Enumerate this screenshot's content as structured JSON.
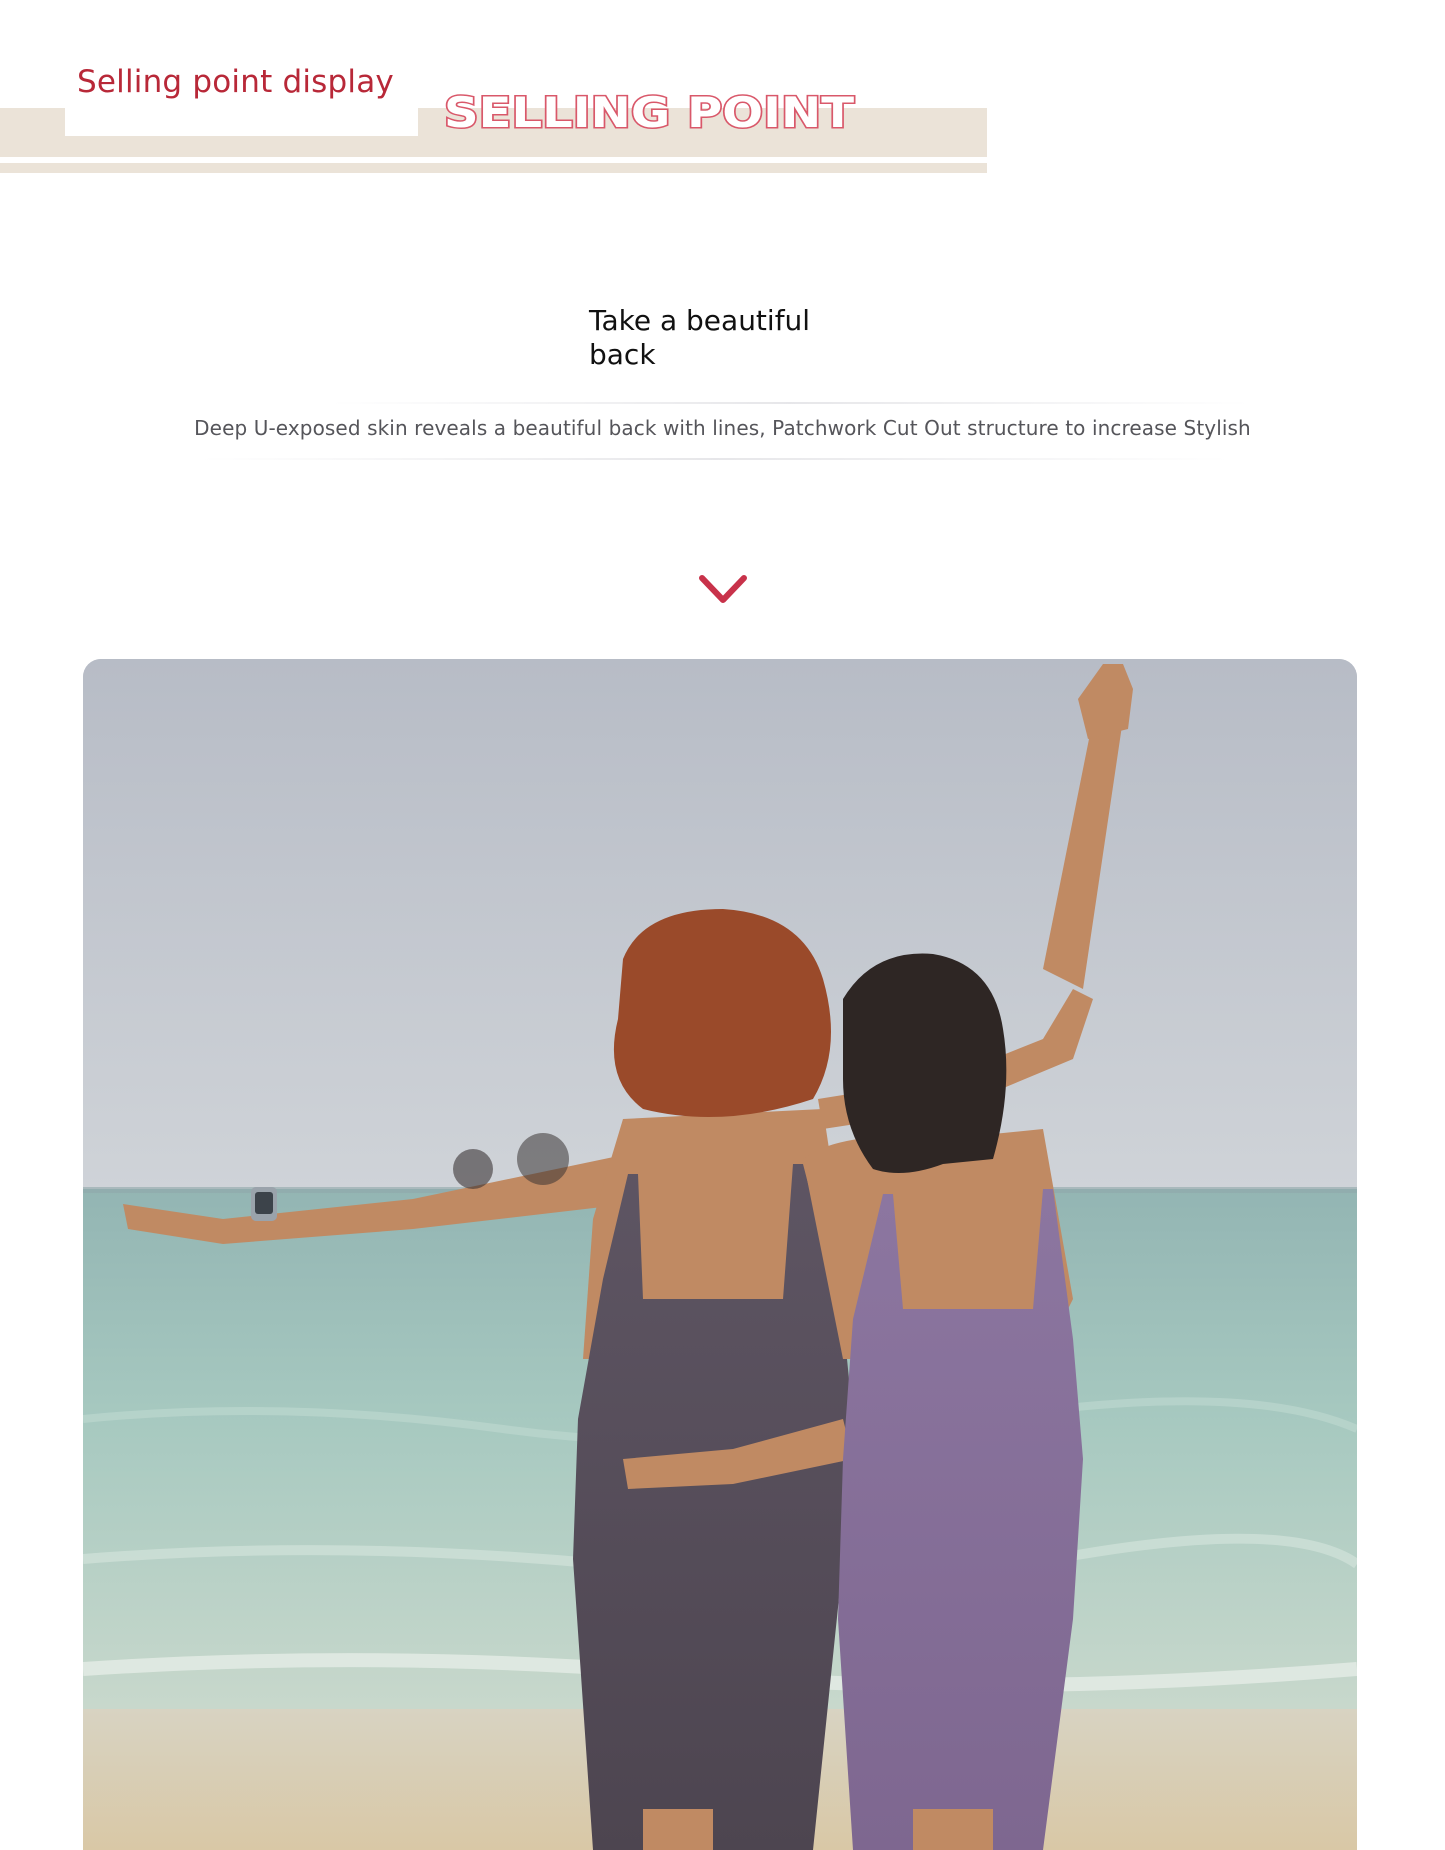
{
  "banner": {
    "title": "Selling point display",
    "wordmark": "SELLING POINT",
    "band_color": "#ebe3d8",
    "accent_color": "#b82838"
  },
  "feature": {
    "headline": "Take a beautiful back",
    "description": "Deep U-exposed skin reveals a beautiful back with lines, Patchwork Cut Out structure to increase Stylish"
  },
  "scroll_indicator": {
    "icon": "chevron-down-icon",
    "color": "#c8324a"
  },
  "photo": {
    "subject": "two women in slip dresses on a beach"
  }
}
